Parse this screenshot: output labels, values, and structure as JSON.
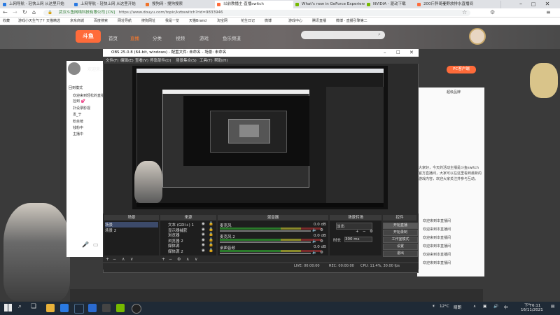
{
  "browser": {
    "tabs": [
      {
        "label": "上网导航 - 轻快上网 从这里开始",
        "color": "#2a7ae2"
      },
      {
        "label": "上网导航 - 轻快上网 从这里开始",
        "color": "#2a7ae2"
      },
      {
        "label": "搜狗网 - 搜狗搜索",
        "color": "#f0732a"
      },
      {
        "label": "以前教播主·直播switch",
        "color": "#ff6b3a",
        "active": true
      },
      {
        "label": "What's new in GeForce Experience",
        "color": "#76b900"
      },
      {
        "label": "NVIDIA - 驱动下载",
        "color": "#76b900"
      },
      {
        "label": "200斤胖哥麦野放排水直播间",
        "color": "#ff6b3a"
      }
    ],
    "url_site": "武汉斗鱼网络科技有限公司 [CN]",
    "url": "https://www.douyu.com/topic/kzbswitch?rid=9833946",
    "bookmarks": [
      "收藏",
      "游戏小天生气了?",
      "天猫精选",
      "京东商城",
      "百度搜索",
      "网址导航",
      "搜狗网址",
      "我是一览",
      "天猫Brand",
      "淘宝网",
      "花生日记",
      "微博",
      "游戏中心",
      "腾讯直播",
      "微博 · 直播引擎第二"
    ]
  },
  "site": {
    "nav": [
      "首页",
      "直播",
      "分类",
      "视频",
      "游戏",
      "鱼乐频道"
    ],
    "active_nav": "直播",
    "fix_button": "PC客户端",
    "chat_title": "欢迎来…",
    "chat_items": [
      "回到模式",
      "欢迎来到轻松的直播间",
      "捡到 💕",
      "扑设录影视",
      "发_于",
      "粉丝榜",
      "钱粉中",
      "主播中"
    ],
    "right_title": "超级品牌",
    "right_items": [
      "欢迎来到本直播间",
      "欢迎来到本直播间",
      "欢迎来到本直播间",
      "欢迎来到本直播间",
      "欢迎来到本直播间",
      "欢迎来到本直播间"
    ],
    "right_desc": "大家好，今天的活动主播是斗鱼switch官方直播间，大家可以在这里看到最新的游戏内容，欢迎大家关注并参与互动。"
  },
  "obs": {
    "title": "OBS 25.0.8 (64-bit, windows) - 配置文件: 未命名 - 场景: 未命名",
    "menu": [
      "文件(F)",
      "编辑(E)",
      "查看(V)",
      "停靠部件(D)",
      "场景集合(S)",
      "工具(T)",
      "帮助(H)"
    ],
    "docks": {
      "scenes": {
        "header": "场景",
        "items": [
          "场景",
          "场景 2"
        ]
      },
      "sources": {
        "header": "来源",
        "items": [
          "文本 (GDI+) 1",
          "显示器捕获",
          "浏览器",
          "浏览器 2",
          "媒体源",
          "媒体源 2"
        ]
      },
      "mixer": {
        "header": "混音器",
        "tracks": [
          "麦克风",
          "麦克风 2",
          "桌面音频"
        ],
        "db": [
          "0.0 dB",
          "0.0 dB",
          "0.0 dB"
        ]
      },
      "transitions": {
        "header": "场景转场",
        "type": "淡出",
        "duration_label": "时长",
        "duration": "300 ms"
      },
      "controls": {
        "header": "控件",
        "buttons": [
          "开始直播",
          "开始录制",
          "工作室模式",
          "设置",
          "退出"
        ]
      }
    },
    "status": {
      "live": "LIVE: 00:00:00",
      "rec": "REC: 00:00:00",
      "cpu": "CPU: 11.4%, 30.00 fps"
    }
  },
  "taskbar": {
    "temp": "12°C",
    "weather": "晴朗",
    "time": "下午6:11",
    "date": "16/11/2021",
    "lang": "中"
  }
}
